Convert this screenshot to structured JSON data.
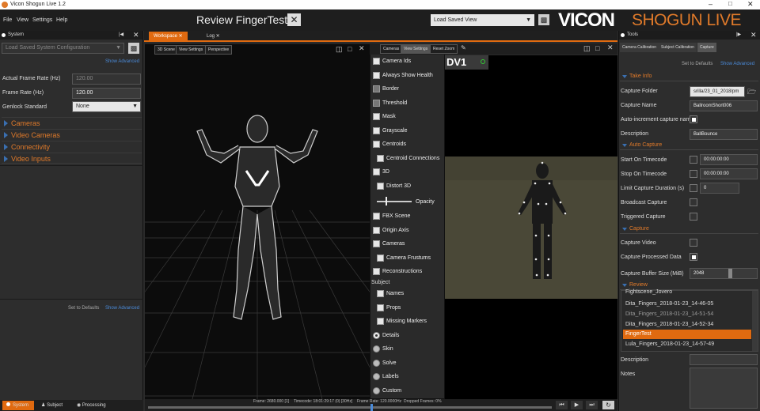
{
  "window_title": "Vicon Shogun Live 1.2",
  "menu": [
    "File",
    "View",
    "Settings",
    "Help"
  ],
  "review_title": "Review FingerTest",
  "load_saved_view": "Load Saved View",
  "logo": {
    "main": "VICON",
    "sub": "SHOGUN LIVE"
  },
  "left": {
    "panel_title": "System",
    "config_placeholder": "Load Saved System Configuration",
    "show_advanced": "Show Advanced",
    "actual_frame_rate_label": "Actual Frame Rate (Hz)",
    "actual_frame_rate": "120.00",
    "frame_rate_label": "Frame Rate (Hz)",
    "frame_rate": "120.00",
    "genlock_label": "Genlock Standard",
    "genlock": "None",
    "sections": [
      "Cameras",
      "Video Cameras",
      "Connectivity",
      "Video Inputs"
    ],
    "set_defaults": "Set to Defaults",
    "show_advanced2": "Show Advanced",
    "bottom_tabs": [
      "System",
      "Subject",
      "Processing"
    ]
  },
  "workspace": {
    "tabs": [
      "Workspace",
      "Log"
    ],
    "view_buttons": [
      "3D Scene",
      "View Settings",
      "Perspective"
    ],
    "right_view_buttons": [
      "Cameras",
      "View Settings",
      "Reset Zoom"
    ],
    "dv_label": "DV1",
    "options": [
      "Camera Ids",
      "Always Show Health",
      "Border",
      "Threshold",
      "Mask",
      "Grayscale",
      "Centroids",
      "Centroid Connections",
      "3D",
      "Distort 3D",
      "Opacity",
      "FBX Scene",
      "Origin Axis",
      "Cameras",
      "Camera Frustums",
      "Reconstructions"
    ],
    "subject_header": "Subject",
    "subject_options": [
      "Names",
      "Props",
      "Missing Markers"
    ],
    "radio_options": [
      "Details",
      "Skin",
      "Solve",
      "Labels",
      "Custom"
    ],
    "status": {
      "frame": "Frame: 2680.000 [1]",
      "timecode": "Timecode: 18:01:29:17 (0) [30Hz]",
      "frame_rate": "Frame Rate: 120.0000Hz",
      "dropped": "Dropped Frames: 0%"
    }
  },
  "right": {
    "panel_title": "Tools",
    "tabs": [
      "Camera Calibration",
      "Subject Calibration",
      "Capture"
    ],
    "set_defaults": "Set to Defaults",
    "show_advanced": "Show Advanced",
    "take_info": "Take Info",
    "capture_folder_label": "Capture Folder",
    "capture_folder": "srilla/23_01_2018/pm",
    "capture_name_label": "Capture Name",
    "capture_name": "BallroomShort006",
    "auto_increment_label": "Auto-increment capture name",
    "description_label": "Description",
    "description": "BallBounce",
    "auto_capture": "Auto Capture",
    "start_tc_label": "Start On Timecode",
    "start_tc": "00:00:00:00",
    "stop_tc_label": "Stop On Timecode",
    "stop_tc": "00:00:00:00",
    "limit_label": "Limit Capture Duration (s)",
    "limit": "0",
    "broadcast_label": "Broadcast Capture",
    "triggered_label": "Triggered Capture",
    "capture": "Capture",
    "capture_video_label": "Capture Video",
    "capture_processed_label": "Capture Processed Data",
    "buffer_label": "Capture Buffer Size (MiB)",
    "buffer": "2048",
    "review": "Review",
    "review_items": [
      "Fightscene_Jovero",
      "Dita_Fingers_2018-01-23_14-46-05",
      "Dita_Fingers_2018-01-23_14-51-54",
      "Dita_Fingers_2018-01-23_14-52-34",
      "FingerTest",
      "Lula_Fingers_2018-01-23_14-57-49"
    ],
    "review_selected": "FingerTest",
    "description2_label": "Description",
    "notes_label": "Notes"
  },
  "colors": {
    "accent": "#e07a2a",
    "link": "#4a8ad8",
    "selected": "#e06a10"
  }
}
